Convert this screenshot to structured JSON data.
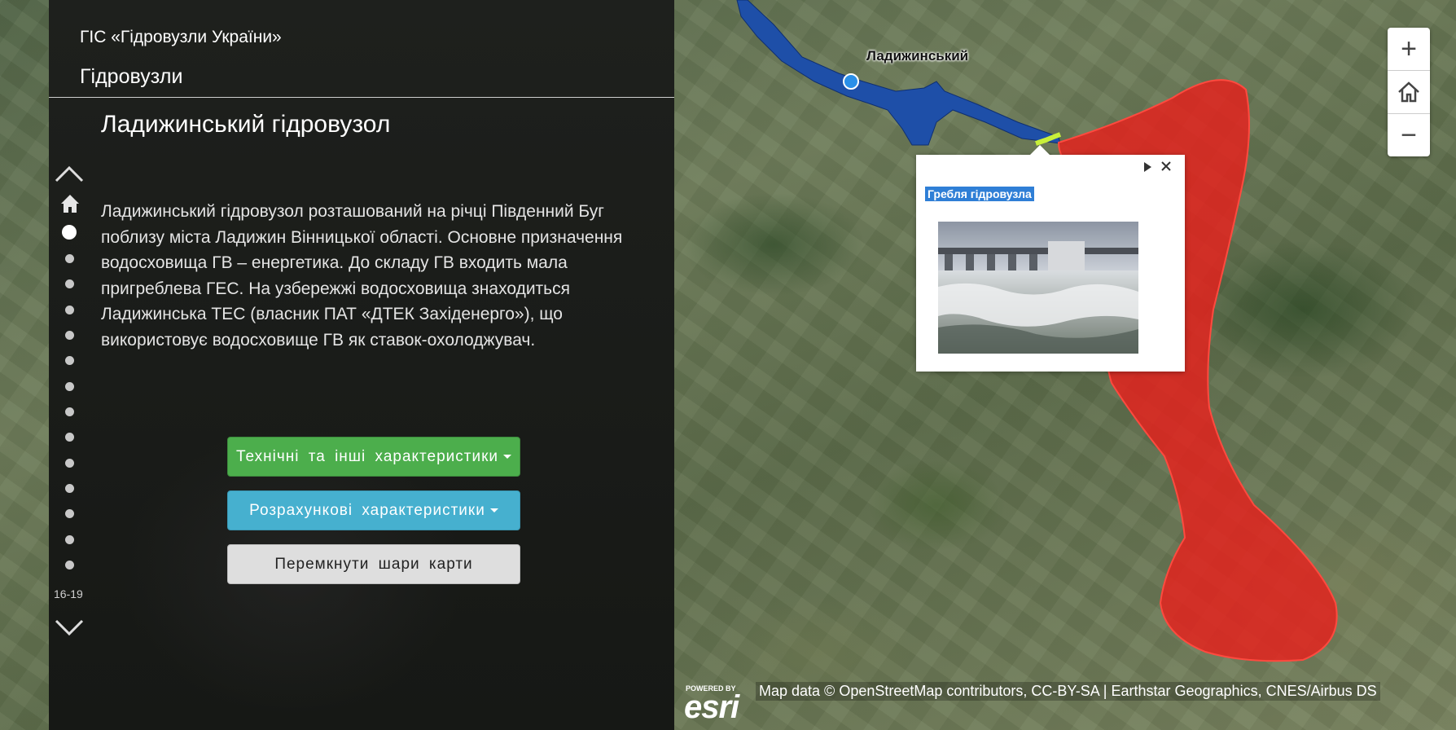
{
  "header": {
    "gis_title": "ГІС «Гідровузли України»",
    "section": "Гідровузли"
  },
  "story": {
    "heading": "Ладижинський гідровузол",
    "description": "Ладижинський гідровузол розташований на річці Південний Буг поблизу міста Ладижин Вінницької області. Основне призначення водосховища ГВ – енергетика. До складу ГВ входить мала пригреблева ГЕС. На узбережжі водосховища знаходиться Ладижинська ТЕС (власник ПАТ «ДТЕК Західенерго»), що використовує водосховище ГВ як ставок-охолоджувач.",
    "page_range": "16-19",
    "active_page_index": 0
  },
  "buttons": {
    "tech": "Технічні та інші характеристики",
    "calc": "Розрахункові характеристики",
    "layers": "Перемкнути шари карти"
  },
  "map": {
    "place_label": "Ладижинський",
    "popup_title": "Гребля гідровузла",
    "attribution": "Map data © OpenStreetMap contributors, CC-BY-SA | Earthstar Geographics, CNES/Airbus DS",
    "esri_powered": "POWERED BY",
    "esri_word": "esri",
    "zoom_in": "+",
    "zoom_out": "−"
  },
  "colors": {
    "flood_zone": "#e8201c",
    "reservoir": "#1e4fa8",
    "marker": "#2a8fe8",
    "btn_tech": "#4cae4c",
    "btn_calc": "#46b0cf",
    "popup_title_bg": "#2f7fd6"
  },
  "icons": {
    "nav_up": "chevron-up-icon",
    "nav_down": "chevron-down-icon",
    "home": "home-icon",
    "popup_next": "play-triangle-icon",
    "popup_close": "close-icon"
  }
}
